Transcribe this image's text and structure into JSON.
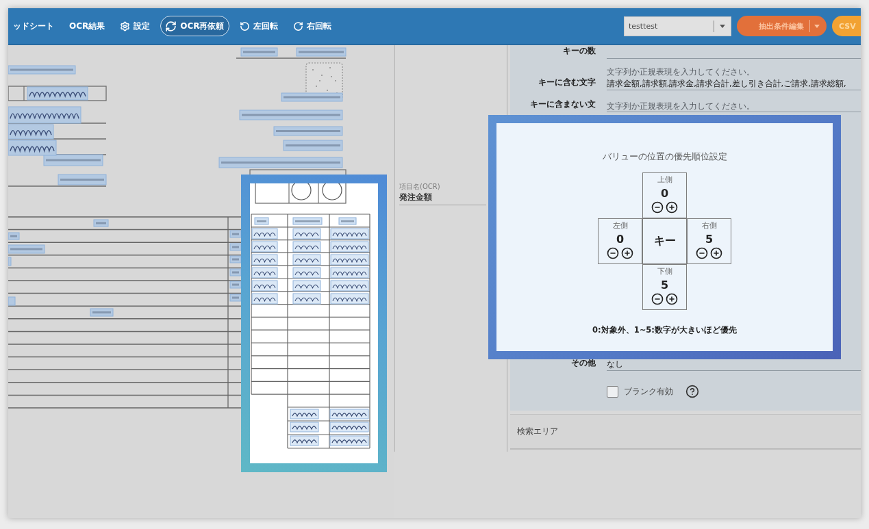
{
  "toolbar": {
    "items": [
      {
        "kind": "plain",
        "label": "ッドシート",
        "selected": false
      },
      {
        "kind": "plain",
        "label": "OCR結果",
        "selected": false
      },
      {
        "kind": "settings",
        "label": "設定",
        "selected": false
      },
      {
        "kind": "rerun",
        "label": "OCR再依頼",
        "selected": true
      },
      {
        "kind": "rotate_left",
        "label": "左回転",
        "selected": false
      },
      {
        "kind": "rotate_right",
        "label": "右回転",
        "selected": false
      }
    ],
    "profile_select": {
      "value": "testtest"
    },
    "edit_button": {
      "label": "抽出条件編集"
    },
    "export_button": {
      "label": "CSV"
    }
  },
  "item_field": {
    "label": "項目名(OCR)",
    "value": "発注金額"
  },
  "settings_form": {
    "fields": [
      {
        "label": "キーの数"
      },
      {
        "label": "キーに含む文字",
        "hint": "文字列か正規表現を入力してください。",
        "value": "請求金額,請求額,請求金,請求合計,差し引き合計,ご請求,請求総額,"
      },
      {
        "label": "キーに含まない文",
        "hint": "文字列か正規表現を入力してください。"
      },
      {
        "label": "その他",
        "value": "なし"
      }
    ],
    "checkbox": {
      "label": "ブランク有効",
      "checked": false
    }
  },
  "search_area": {
    "title": "検索エリア"
  },
  "priority_popup": {
    "title": "バリューの位置の優先順位設定",
    "cells": [
      {
        "kind": "stepper",
        "label": "上側",
        "value": "0"
      },
      {
        "kind": "stepper",
        "label": "左側",
        "value": "0"
      },
      {
        "kind": "key",
        "label": "キー"
      },
      {
        "kind": "stepper",
        "label": "右側",
        "value": "5"
      },
      {
        "kind": "stepper",
        "label": "下側",
        "value": "5"
      }
    ],
    "note": "0:対象外、1~5:数字が大きいほど優先"
  }
}
